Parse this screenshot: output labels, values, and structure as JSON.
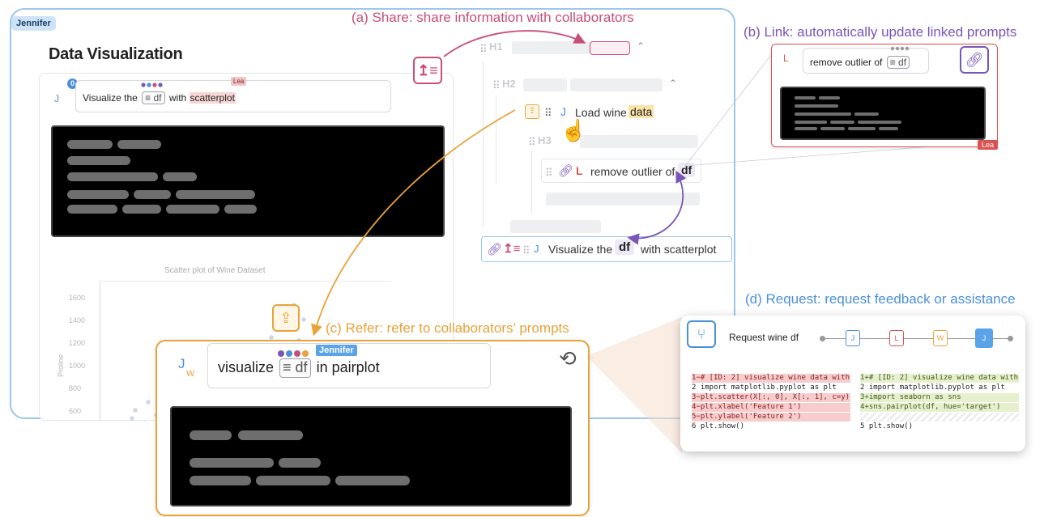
{
  "user_tag": "Jennifer",
  "page_title": "Data Visualization",
  "captions": {
    "share": "(a) Share: share information with collaborators",
    "link": "(b) Link:  automatically update linked prompts",
    "refer": "(c) Refer:  refer to collaborators’ prompts",
    "request": "(d) Request: request feedback or assistance"
  },
  "colors": {
    "share": "#c94d7a",
    "link": "#7a55b8",
    "refer": "#e8a33a",
    "request": "#4a90d9",
    "jennifer": "#4a90d9",
    "lea": "#d9534f"
  },
  "main_prompt": {
    "avatar": "J",
    "badge": "0",
    "text_before": "Visualize the",
    "chip": "≡ df",
    "text_between": "with",
    "highlight": "scatterplot",
    "tag": "Lea"
  },
  "scatter": {
    "title": "Scatter plot of Wine Dataset",
    "ylabel": "Proline",
    "yticks": [
      "1600",
      "1400",
      "1200",
      "1000",
      "800",
      "600"
    ]
  },
  "outline": {
    "h1": "H1",
    "h2": "H2",
    "h3": "H3",
    "load_item": {
      "avatar": "J",
      "text": "Load wine",
      "highlight": "data"
    },
    "outlier_item": {
      "avatar": "L",
      "text": "remove outlier of",
      "chip": "df"
    },
    "visualize_item": {
      "avatar": "J",
      "text_before": "Visualize the",
      "chip": "df",
      "text_after": "with scatterplot"
    }
  },
  "link_panel": {
    "avatar": "L",
    "text": "remove outlier of",
    "chip": "≡ df",
    "tag": "Lea"
  },
  "refer_card": {
    "avatar_top": "J",
    "avatar_bottom": "W",
    "text_before": "visualize",
    "chip": "≡ df",
    "tag": "Jennifer",
    "text_after": "in pairplot"
  },
  "request": {
    "title": "Request wine df",
    "steps": [
      "J",
      "L",
      "W",
      "J"
    ],
    "left_lines": [
      {
        "no": "1",
        "mark": "−",
        "code": "# [ID: 2] visualize wine data with sc",
        "type": "del"
      },
      {
        "no": "2",
        "mark": " ",
        "code": "import matplotlib.pyplot as plt",
        "type": "ctx"
      },
      {
        "no": "3",
        "mark": "−",
        "code": "plt.scatter(X[:, 0], X[:, 1], c=y)",
        "type": "del"
      },
      {
        "no": "4",
        "mark": "−",
        "code": "plt.xlabel('Feature 1')",
        "type": "del"
      },
      {
        "no": "5",
        "mark": "−",
        "code": "plt.ylabel('Feature 2')",
        "type": "del"
      },
      {
        "no": "6",
        "mark": " ",
        "code": "plt.show()",
        "type": "ctx"
      }
    ],
    "right_lines": [
      {
        "no": "1",
        "mark": "+",
        "code": "# [ID: 2] visualize wine data with",
        "type": "add"
      },
      {
        "no": "2",
        "mark": " ",
        "code": "import matplotlib.pyplot as plt",
        "type": "ctx"
      },
      {
        "no": "3",
        "mark": "+",
        "code": "import seaborn as sns",
        "type": "add"
      },
      {
        "no": "4",
        "mark": "+",
        "code": "sns.pairplot(df, hue='target')",
        "type": "add"
      },
      {
        "no": "",
        "mark": "",
        "code": "",
        "type": "hatch"
      },
      {
        "no": "5",
        "mark": " ",
        "code": "plt.show()",
        "type": "ctx"
      }
    ]
  }
}
